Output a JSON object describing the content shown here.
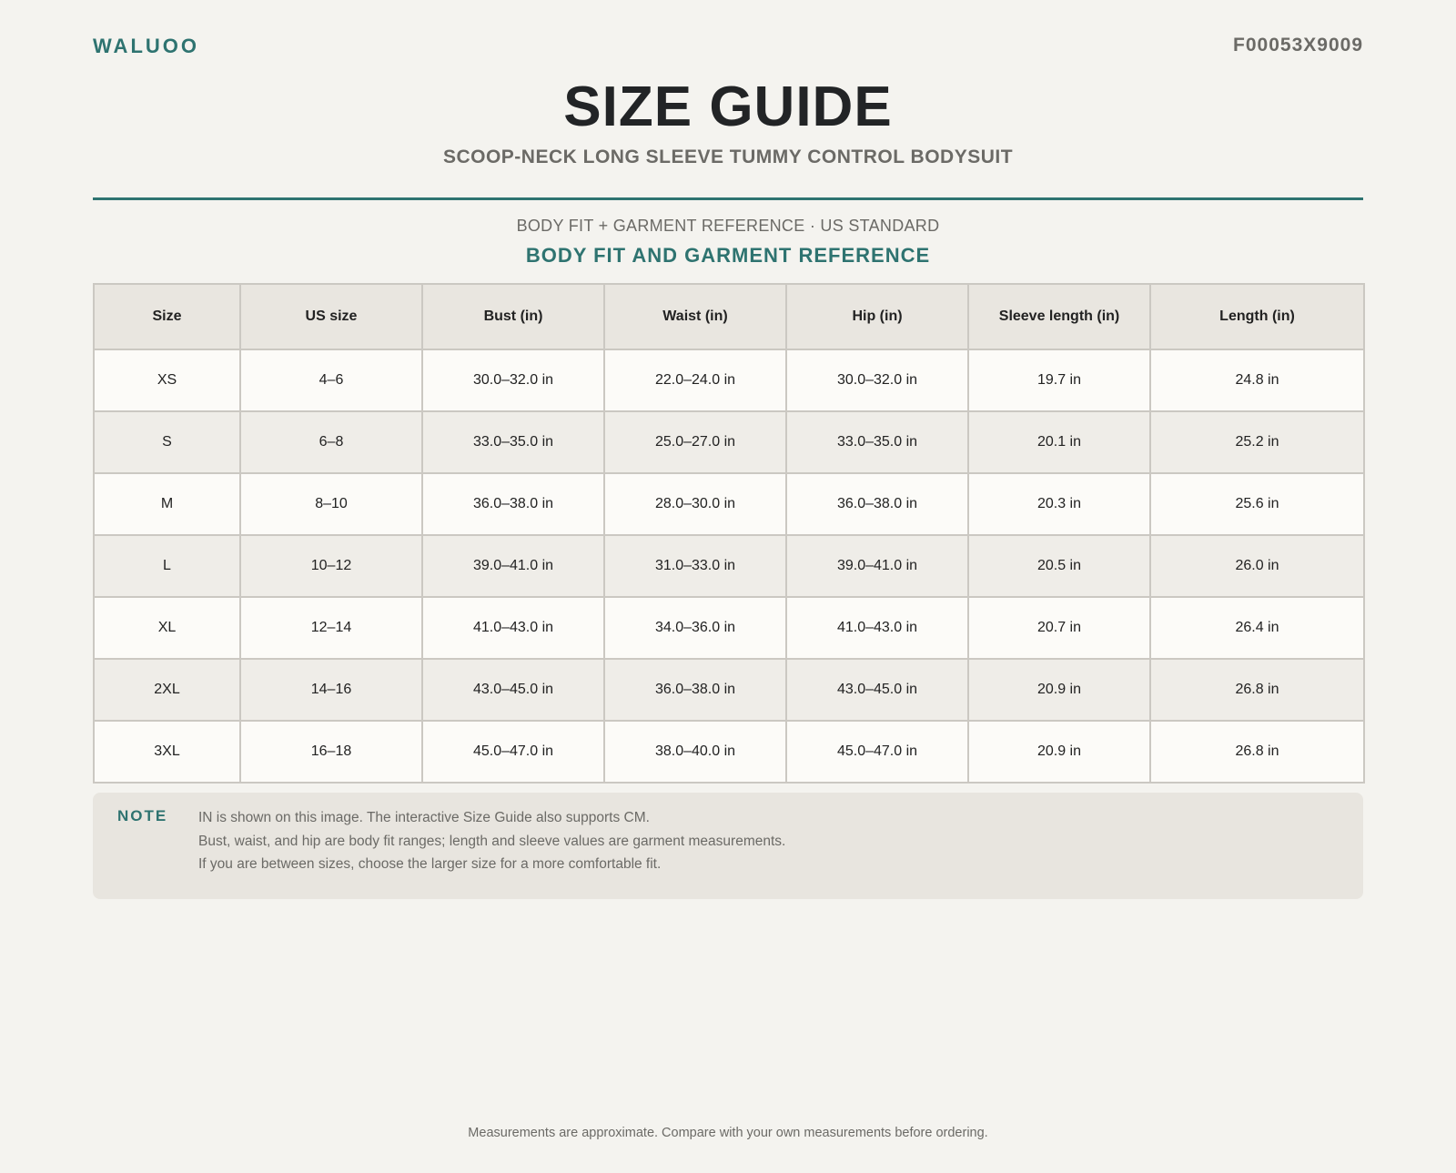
{
  "header": {
    "brand": "WALUOO",
    "product_code": "F00053X9009",
    "title": "SIZE GUIDE",
    "subtitle": "SCOOP-NECK LONG SLEEVE TUMMY CONTROL BODYSUIT"
  },
  "section": {
    "kicker": "BODY FIT + GARMENT REFERENCE · US STANDARD",
    "title": "BODY FIT AND GARMENT REFERENCE"
  },
  "table": {
    "headers": [
      "Size",
      "US size",
      "Bust (in)",
      "Waist (in)",
      "Hip (in)",
      "Sleeve length (in)",
      "Length (in)"
    ],
    "rows": [
      [
        "XS",
        "4–6",
        "30.0–32.0 in",
        "22.0–24.0 in",
        "30.0–32.0 in",
        "19.7 in",
        "24.8 in"
      ],
      [
        "S",
        "6–8",
        "33.0–35.0 in",
        "25.0–27.0 in",
        "33.0–35.0 in",
        "20.1 in",
        "25.2 in"
      ],
      [
        "M",
        "8–10",
        "36.0–38.0 in",
        "28.0–30.0 in",
        "36.0–38.0 in",
        "20.3 in",
        "25.6 in"
      ],
      [
        "L",
        "10–12",
        "39.0–41.0 in",
        "31.0–33.0 in",
        "39.0–41.0 in",
        "20.5 in",
        "26.0 in"
      ],
      [
        "XL",
        "12–14",
        "41.0–43.0 in",
        "34.0–36.0 in",
        "41.0–43.0 in",
        "20.7 in",
        "26.4 in"
      ],
      [
        "2XL",
        "14–16",
        "43.0–45.0 in",
        "36.0–38.0 in",
        "43.0–45.0 in",
        "20.9 in",
        "26.8 in"
      ],
      [
        "3XL",
        "16–18",
        "45.0–47.0 in",
        "38.0–40.0 in",
        "45.0–47.0 in",
        "20.9 in",
        "26.8 in"
      ]
    ]
  },
  "note": {
    "label": "NOTE",
    "lines": [
      "IN is shown on this image. The interactive Size Guide also supports CM.",
      "Bust, waist, and hip are body fit ranges; length and sleeve values are garment measurements.",
      "If you are between sizes, choose the larger size for a more comfortable fit."
    ]
  },
  "footer": {
    "text": "Measurements are approximate. Compare with your own measurements before ordering."
  },
  "colors": {
    "accent": "#2e7370",
    "background": "#f4f3ef",
    "muted_text": "#6b6a66"
  }
}
